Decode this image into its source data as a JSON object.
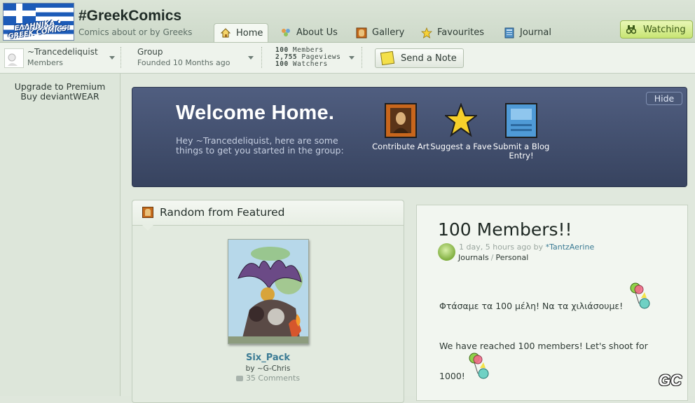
{
  "header": {
    "logo_text": "ΕΛΛΗΝΙΚΑ • GREEK COMICS!",
    "group_name": "#GreekComics",
    "group_tagline": "Comics about or by Greeks",
    "tabs": [
      {
        "label": "Home",
        "icon": "home-icon",
        "active": true
      },
      {
        "label": "About Us",
        "icon": "people-icon",
        "active": false
      },
      {
        "label": "Gallery",
        "icon": "gallery-icon",
        "active": false
      },
      {
        "label": "Favourites",
        "icon": "star-icon",
        "active": false
      },
      {
        "label": "Journal",
        "icon": "journal-icon",
        "active": false
      }
    ],
    "watching_label": "Watching"
  },
  "subbar": {
    "user_name": "~Trancedeliquist",
    "user_role": "Members",
    "group_label": "Group",
    "group_founded": "Founded 10 Months ago",
    "stats": [
      {
        "value": "100",
        "label": "Members"
      },
      {
        "value": "2,755",
        "label": "Pageviews"
      },
      {
        "value": "100",
        "label": "Watchers"
      }
    ],
    "send_note_label": "Send a Note"
  },
  "sidebar": {
    "links": [
      "Upgrade to Premium",
      "Buy deviantWEAR"
    ]
  },
  "welcome": {
    "title": "Welcome Home.",
    "blurb": "Hey ~Trancedeliquist, here are some things to get you started in the group:",
    "hide_label": "Hide",
    "actions": [
      {
        "label": "Contribute Art",
        "icon": "contribute-art-icon"
      },
      {
        "label": "Suggest a Fave",
        "icon": "suggest-fave-icon"
      },
      {
        "label": "Submit a Blog Entry!",
        "icon": "blog-entry-icon"
      }
    ]
  },
  "featured": {
    "heading": "Random from Featured",
    "art_title": "Six_Pack",
    "art_by": "by ~G-Chris",
    "comments": "35 Comments"
  },
  "journal": {
    "title": "100 Members!!",
    "time": "1 day, 5 hours ago by",
    "author": "*TantzAerine",
    "category": "Journals",
    "subcategory": "Personal",
    "greek_text": "Φτάσαμε τα 100 μέλη! Να τα χιλιάσουμε!",
    "english_text_line1": "We have reached 100 members! Let's shoot for",
    "english_text_line2": "1000!"
  },
  "watermark": "GC",
  "colors": {
    "welcome_bg": "#3f4b6a",
    "accent_link": "#3b7b94",
    "watching_bg": "#d4ec8c"
  }
}
